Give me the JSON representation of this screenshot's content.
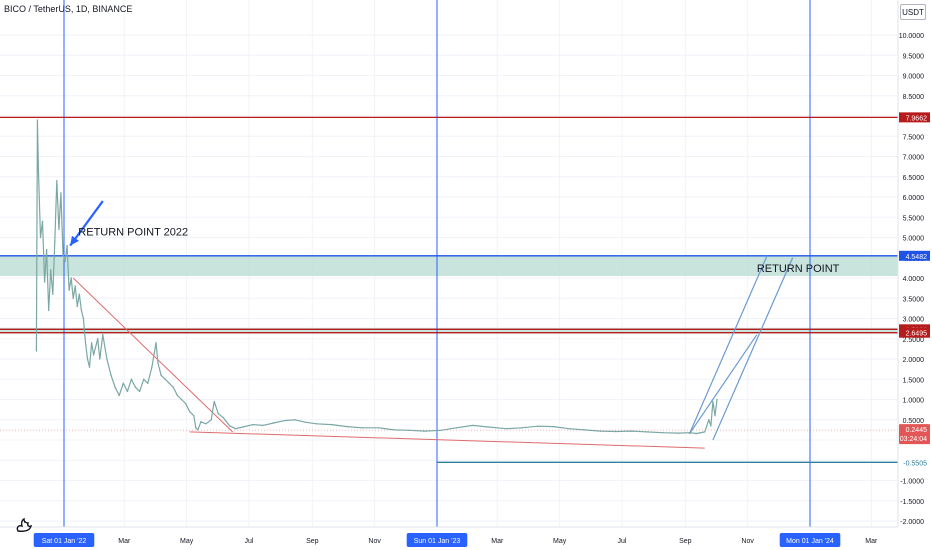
{
  "symbol_title": "BICO / TetherUS, 1D, BINANCE",
  "currency": "USDT",
  "logo_icon": "tradingview-logo-icon",
  "chart_data": {
    "type": "line",
    "title": "BICO / TetherUS, 1D, BINANCE",
    "ylim": [
      -2.0,
      10.5
    ],
    "y_ticks": [
      10.0,
      9.5,
      9.0,
      8.5,
      8.0,
      7.5,
      7.0,
      6.5,
      6.0,
      5.5,
      5.0,
      4.5,
      4.0,
      3.5,
      3.0,
      2.5,
      2.0,
      1.5,
      1.0,
      0.5,
      0.0,
      -0.5,
      -1.0,
      -1.5,
      -2.0
    ],
    "y_tick_labels": [
      "10.0000",
      "9.5000",
      "9.0000",
      "8.5000",
      "8.0000",
      "7.5000",
      "7.0000",
      "6.5000",
      "6.0000",
      "5.5000",
      "5.0000",
      "4.5000",
      "4.0000",
      "3.5000",
      "3.0000",
      "2.5000",
      "2.0000",
      "1.5000",
      "1.0000",
      "0.5000",
      "0.0000",
      "-0.5000",
      "-1.0000",
      "-1.5000",
      "-2.0000"
    ],
    "x_ticks": [
      {
        "date": "2022-01-01",
        "label": "Sat 01 Jan '22",
        "highlight": true
      },
      {
        "date": "2022-03-01",
        "label": "Mar",
        "highlight": false
      },
      {
        "date": "2022-05-01",
        "label": "May",
        "highlight": false
      },
      {
        "date": "2022-07-01",
        "label": "Jul",
        "highlight": false
      },
      {
        "date": "2022-09-01",
        "label": "Sep",
        "highlight": false
      },
      {
        "date": "2022-11-01",
        "label": "Nov",
        "highlight": false
      },
      {
        "date": "2023-01-01",
        "label": "Sun 01 Jan '23",
        "highlight": true
      },
      {
        "date": "2023-03-01",
        "label": "Mar",
        "highlight": false
      },
      {
        "date": "2023-05-01",
        "label": "May",
        "highlight": false
      },
      {
        "date": "2023-07-01",
        "label": "Jul",
        "highlight": false
      },
      {
        "date": "2023-09-01",
        "label": "Sep",
        "highlight": false
      },
      {
        "date": "2023-11-01",
        "label": "Nov",
        "highlight": false
      },
      {
        "date": "2024-01-01",
        "label": "Mon 01 Jan '24",
        "highlight": true
      },
      {
        "date": "2024-03-01",
        "label": "Mar",
        "highlight": false
      }
    ],
    "price_series": {
      "color": "#7ba7a5",
      "points": [
        [
          "2021-12-05",
          2.2
        ],
        [
          "2021-12-06",
          7.9
        ],
        [
          "2021-12-07",
          6.6
        ],
        [
          "2021-12-09",
          5.0
        ],
        [
          "2021-12-11",
          5.4
        ],
        [
          "2021-12-13",
          3.9
        ],
        [
          "2021-12-15",
          4.7
        ],
        [
          "2021-12-17",
          3.2
        ],
        [
          "2021-12-19",
          4.2
        ],
        [
          "2021-12-21",
          3.6
        ],
        [
          "2021-12-23",
          4.9
        ],
        [
          "2021-12-25",
          6.4
        ],
        [
          "2021-12-27",
          5.2
        ],
        [
          "2021-12-29",
          6.1
        ],
        [
          "2021-12-31",
          4.6
        ],
        [
          "2022-01-02",
          4.4
        ],
        [
          "2022-01-04",
          4.8
        ],
        [
          "2022-01-06",
          3.7
        ],
        [
          "2022-01-08",
          4.0
        ],
        [
          "2022-01-10",
          3.5
        ],
        [
          "2022-01-12",
          3.8
        ],
        [
          "2022-01-14",
          3.3
        ],
        [
          "2022-01-16",
          3.6
        ],
        [
          "2022-01-18",
          3.2
        ],
        [
          "2022-01-20",
          3.0
        ],
        [
          "2022-01-22",
          2.4
        ],
        [
          "2022-01-24",
          2.0
        ],
        [
          "2022-01-26",
          1.8
        ],
        [
          "2022-01-28",
          2.4
        ],
        [
          "2022-01-30",
          2.1
        ],
        [
          "2022-02-03",
          2.5
        ],
        [
          "2022-02-05",
          2.0
        ],
        [
          "2022-02-08",
          2.6
        ],
        [
          "2022-02-12",
          2.0
        ],
        [
          "2022-02-16",
          1.6
        ],
        [
          "2022-02-20",
          1.3
        ],
        [
          "2022-02-24",
          1.1
        ],
        [
          "2022-02-28",
          1.4
        ],
        [
          "2022-03-04",
          1.2
        ],
        [
          "2022-03-08",
          1.5
        ],
        [
          "2022-03-12",
          1.3
        ],
        [
          "2022-03-16",
          1.2
        ],
        [
          "2022-03-20",
          1.5
        ],
        [
          "2022-03-24",
          1.4
        ],
        [
          "2022-03-28",
          1.8
        ],
        [
          "2022-04-01",
          2.4
        ],
        [
          "2022-04-03",
          1.9
        ],
        [
          "2022-04-06",
          1.6
        ],
        [
          "2022-04-10",
          1.5
        ],
        [
          "2022-04-14",
          1.4
        ],
        [
          "2022-04-18",
          1.3
        ],
        [
          "2022-04-22",
          1.1
        ],
        [
          "2022-04-26",
          1.0
        ],
        [
          "2022-04-30",
          0.9
        ],
        [
          "2022-05-04",
          0.7
        ],
        [
          "2022-05-08",
          0.6
        ],
        [
          "2022-05-10",
          0.3
        ],
        [
          "2022-05-12",
          0.25
        ],
        [
          "2022-05-15",
          0.45
        ],
        [
          "2022-05-20",
          0.4
        ],
        [
          "2022-05-25",
          0.5
        ],
        [
          "2022-05-28",
          0.95
        ],
        [
          "2022-06-01",
          0.65
        ],
        [
          "2022-06-06",
          0.55
        ],
        [
          "2022-06-12",
          0.35
        ],
        [
          "2022-06-18",
          0.28
        ],
        [
          "2022-06-25",
          0.32
        ],
        [
          "2022-07-05",
          0.38
        ],
        [
          "2022-07-15",
          0.36
        ],
        [
          "2022-07-25",
          0.42
        ],
        [
          "2022-08-05",
          0.48
        ],
        [
          "2022-08-15",
          0.5
        ],
        [
          "2022-08-25",
          0.44
        ],
        [
          "2022-09-05",
          0.4
        ],
        [
          "2022-09-20",
          0.38
        ],
        [
          "2022-10-05",
          0.33
        ],
        [
          "2022-10-20",
          0.3
        ],
        [
          "2022-11-05",
          0.3
        ],
        [
          "2022-11-20",
          0.25
        ],
        [
          "2022-12-05",
          0.24
        ],
        [
          "2022-12-20",
          0.22
        ],
        [
          "2023-01-05",
          0.24
        ],
        [
          "2023-01-20",
          0.3
        ],
        [
          "2023-02-05",
          0.36
        ],
        [
          "2023-02-20",
          0.32
        ],
        [
          "2023-03-10",
          0.28
        ],
        [
          "2023-03-25",
          0.3
        ],
        [
          "2023-04-10",
          0.34
        ],
        [
          "2023-04-25",
          0.33
        ],
        [
          "2023-05-10",
          0.28
        ],
        [
          "2023-05-25",
          0.25
        ],
        [
          "2023-06-10",
          0.22
        ],
        [
          "2023-06-25",
          0.21
        ],
        [
          "2023-07-10",
          0.22
        ],
        [
          "2023-07-25",
          0.2
        ],
        [
          "2023-08-10",
          0.18
        ],
        [
          "2023-08-25",
          0.17
        ],
        [
          "2023-09-05",
          0.18
        ],
        [
          "2023-09-12",
          0.16
        ],
        [
          "2023-09-20",
          0.2
        ],
        [
          "2023-09-24",
          0.5
        ],
        [
          "2023-09-26",
          0.35
        ],
        [
          "2023-09-28",
          0.95
        ],
        [
          "2023-09-30",
          0.6
        ],
        [
          "2023-10-02",
          1.0
        ]
      ]
    },
    "horizontal_lines": [
      {
        "value": 7.9662,
        "label": "7.9662",
        "color": "#b71c1c"
      },
      {
        "value": 4.5482,
        "label": "4.5482",
        "color": "#1e53e5"
      },
      {
        "value": 2.7328,
        "label": "2.7328",
        "color": "#b71c1c"
      },
      {
        "value": 2.6495,
        "label": "2.6495",
        "color": "#b71c1c"
      },
      {
        "value": -0.5505,
        "label": "-0.5505",
        "color": "#2f7f9e"
      }
    ],
    "zones": [
      {
        "from": 4.55,
        "to": 4.05,
        "color": "#b7dbd2"
      },
      {
        "from": 2.77,
        "to": 2.63,
        "color": "#b7dbd2"
      }
    ],
    "vertical_lines": [
      "2022-01-01",
      "2023-01-01",
      "2024-01-01"
    ],
    "current_price": {
      "value": 0.2445,
      "label": "0.2445",
      "countdown": "03:24:04",
      "color": "#e35656"
    },
    "annotations": [
      {
        "text": "RETURN POINT 2022",
        "date": "2022-01-15",
        "value": 5.05
      },
      {
        "text": "RETURN POINT",
        "date": "2023-11-10",
        "value": 4.15
      }
    ],
    "arrow": {
      "from": [
        "2022-02-08",
        5.9
      ],
      "to": [
        "2022-01-07",
        4.8
      ],
      "color": "#2962ff"
    },
    "trendlines": [
      {
        "from": [
          "2022-01-10",
          4.0
        ],
        "to": [
          "2022-06-15",
          0.2
        ],
        "color": "#e06b6b"
      },
      {
        "from": [
          "2022-05-04",
          0.2
        ],
        "to": [
          "2023-09-20",
          -0.2
        ],
        "color": "#e06b6b"
      }
    ],
    "channel_lines": [
      {
        "from": [
          "2023-09-05",
          0.15
        ],
        "to": [
          "2023-11-20",
          4.55
        ],
        "color": "#6a9bd1"
      },
      {
        "from": [
          "2023-09-28",
          0.0
        ],
        "to": [
          "2023-12-15",
          4.5
        ],
        "color": "#6a9bd1"
      },
      {
        "from": [
          "2023-09-05",
          0.15
        ],
        "to": [
          "2023-11-10",
          2.6
        ],
        "color": "#6a9bd1"
      }
    ]
  }
}
